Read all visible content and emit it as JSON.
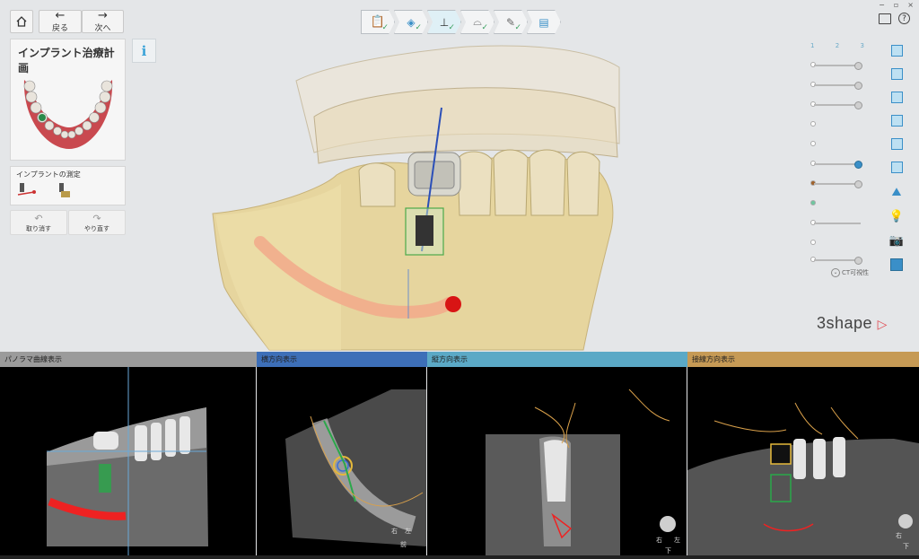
{
  "toolbar": {
    "home_icon": "home-icon",
    "back_label": "戻る",
    "next_label": "次へ",
    "window_controls": [
      "−",
      "▫",
      "×"
    ]
  },
  "left_panel": {
    "title": "インプラント治療計画",
    "info_label": "i",
    "measure_title": "インプラントの測定",
    "undo_label": "取り消す",
    "redo_label": "やり直す"
  },
  "workflow": {
    "steps": [
      {
        "icon": "clipboard-icon",
        "done": true
      },
      {
        "icon": "scan-icon",
        "done": true
      },
      {
        "icon": "implant-icon",
        "done": true,
        "active": true
      },
      {
        "icon": "guide-icon",
        "done": true
      },
      {
        "icon": "design-icon",
        "done": true
      },
      {
        "icon": "export-icon",
        "done": false
      }
    ]
  },
  "right_tools": {
    "tabs": [
      "1",
      "2",
      "3"
    ],
    "ct_label": "CT可視性",
    "brand": "3shape"
  },
  "panes": [
    {
      "title": "パノラマ曲線表示",
      "color": "#9b9b9b"
    },
    {
      "title": "横方向表示",
      "color": "#3d6fb8"
    },
    {
      "title": "縦方向表示",
      "color": "#5ba9c6"
    },
    {
      "title": "接線方向表示",
      "color": "#c69a55"
    }
  ],
  "orientation": {
    "right": "右",
    "left": "左",
    "front": "前",
    "bottom": "下"
  },
  "colors": {
    "accent": "#3aa3d8",
    "brand_arrow": "#e0484f",
    "nerve": "#ee2222",
    "implant_green": "#2aa84a"
  }
}
